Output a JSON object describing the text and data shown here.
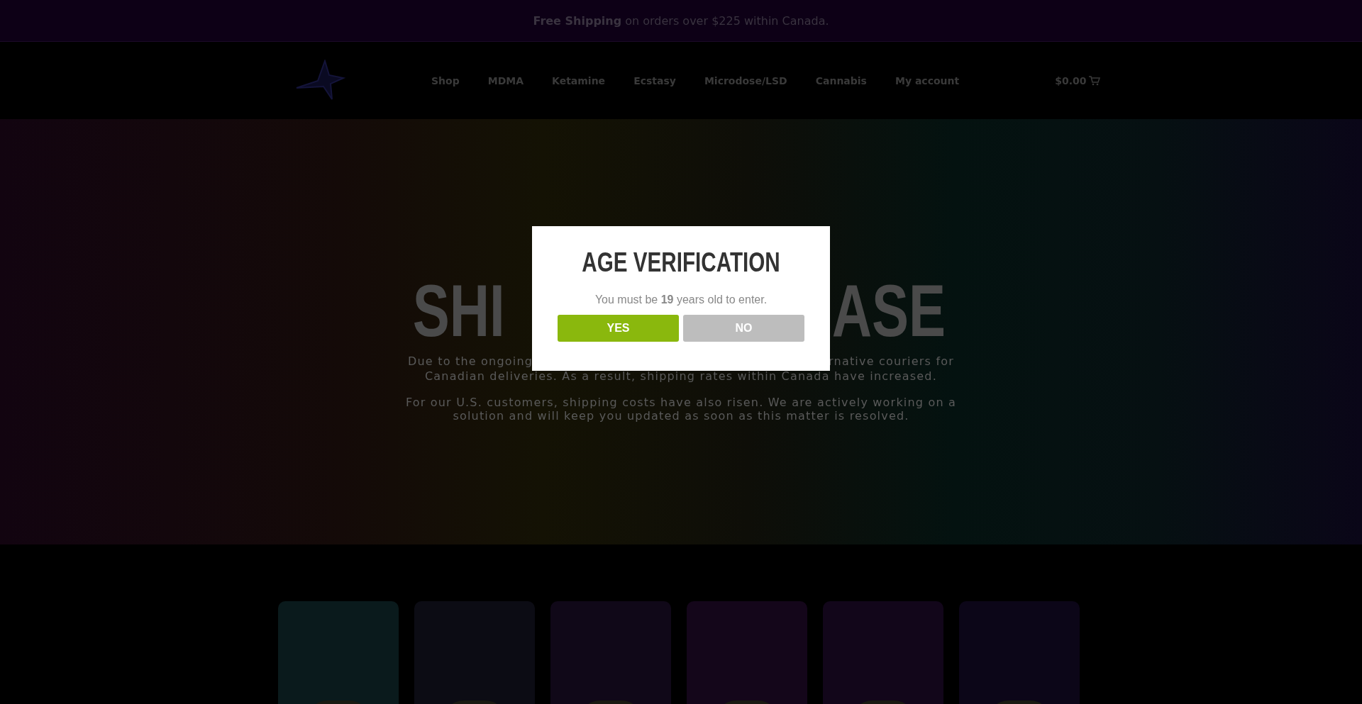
{
  "announcement": "**Free Shipping** on orders over $225 within Canada.",
  "nav": {
    "items": [
      {
        "label": "Shop"
      },
      {
        "label": "MDMA"
      },
      {
        "label": "Ketamine"
      },
      {
        "label": "Ecstasy"
      },
      {
        "label": "Microdose/LSD"
      },
      {
        "label": "Cannabis"
      },
      {
        "label": "My account"
      }
    ],
    "cart_total": "$0.00"
  },
  "hero": {
    "title_left": "SHI",
    "title_right": "ASE",
    "line_1_left": "Due to the ongoing",
    "line_1_right": "rnative couriers for",
    "line_2": "Canadian deliveries. As a result, shipping rates within Canada have increased.",
    "paragraph_2": "For our U.S. customers, shipping costs have also risen. We are actively working on a solution and will keep you updated as soon as this matter is resolved."
  },
  "product_cards": [
    {
      "color": "#0a1a1c"
    },
    {
      "color": "#0c0c14"
    },
    {
      "color": "#100818"
    },
    {
      "color": "#14061a"
    },
    {
      "color": "#12061a"
    },
    {
      "color": "#0c0618"
    }
  ],
  "modal": {
    "title": "AGE VERIFICATION",
    "message": "You must be **19** years old to enter.",
    "buttons": [
      {
        "label": "YES",
        "kind": "primary"
      },
      {
        "label": "NO",
        "kind": "secondary"
      }
    ]
  }
}
